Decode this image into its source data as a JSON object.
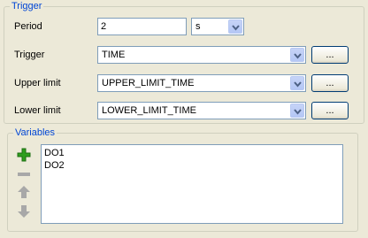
{
  "trigger_group": {
    "title": "Trigger",
    "period": {
      "label": "Period",
      "value": "2",
      "unit": "s"
    },
    "trigger": {
      "label": "Trigger",
      "value": "TIME",
      "button": "..."
    },
    "upper_limit": {
      "label": "Upper limit",
      "value": "UPPER_LIMIT_TIME",
      "button": "..."
    },
    "lower_limit": {
      "label": "Lower limit",
      "value": "LOWER_LIMIT_TIME",
      "button": "..."
    }
  },
  "variables_group": {
    "title": "Variables",
    "items": [
      "DO1",
      "DO2"
    ],
    "icons": [
      "add-icon",
      "remove-icon",
      "move-up-icon",
      "move-down-icon"
    ]
  },
  "colors": {
    "accent": "#0046d5",
    "add": "#2f9e1f",
    "disabled": "#a8a8a8"
  }
}
